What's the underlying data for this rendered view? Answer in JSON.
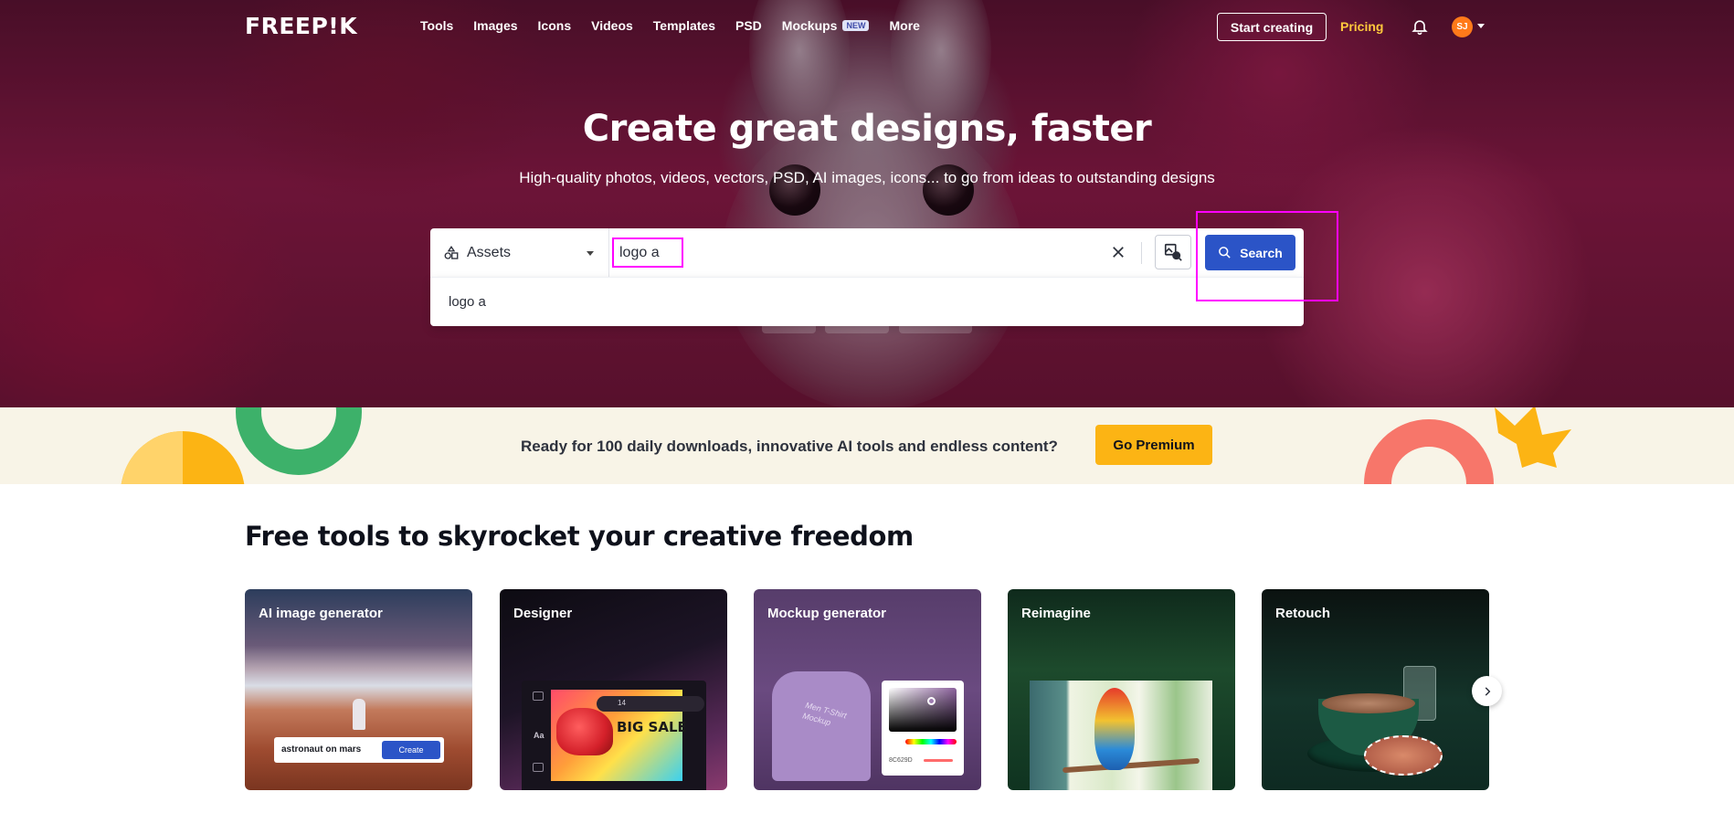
{
  "nav": {
    "logo": "FREEP!K",
    "links": [
      "Tools",
      "Images",
      "Icons",
      "Videos",
      "Templates",
      "PSD",
      "Mockups",
      "More"
    ],
    "mockups_badge": "NEW",
    "start_creating": "Start creating",
    "pricing": "Pricing",
    "avatar_initials": "SJ"
  },
  "hero": {
    "headline": "Create great designs, faster",
    "subline": "High-quality photos, videos, vectors, PSD, AI images, icons... to go from ideas to outstanding designs"
  },
  "search": {
    "asset_type": "Assets",
    "query": "logo a",
    "search_label": "Search",
    "suggestions": [
      "logo a"
    ]
  },
  "promo": {
    "text": "Ready for 100 daily downloads, innovative AI tools and endless content?",
    "button": "Go Premium"
  },
  "tools": {
    "title": "Free tools to skyrocket your creative freedom",
    "cards": [
      {
        "title": "AI image generator",
        "prompt": "astronaut on mars",
        "cta": "Create"
      },
      {
        "title": "Designer",
        "font_size": "14",
        "sale_text": "BIG SALE",
        "side_label": "Aa"
      },
      {
        "title": "Mockup generator",
        "shirt_text": "Men T-Shirt Mockup",
        "hex": "8C629D"
      },
      {
        "title": "Reimagine"
      },
      {
        "title": "Retouch"
      }
    ]
  },
  "colors": {
    "accent": "#2b54c7",
    "premium": "#fcb414",
    "pricing": "#ffc93c",
    "highlight": "#ff00ff"
  }
}
